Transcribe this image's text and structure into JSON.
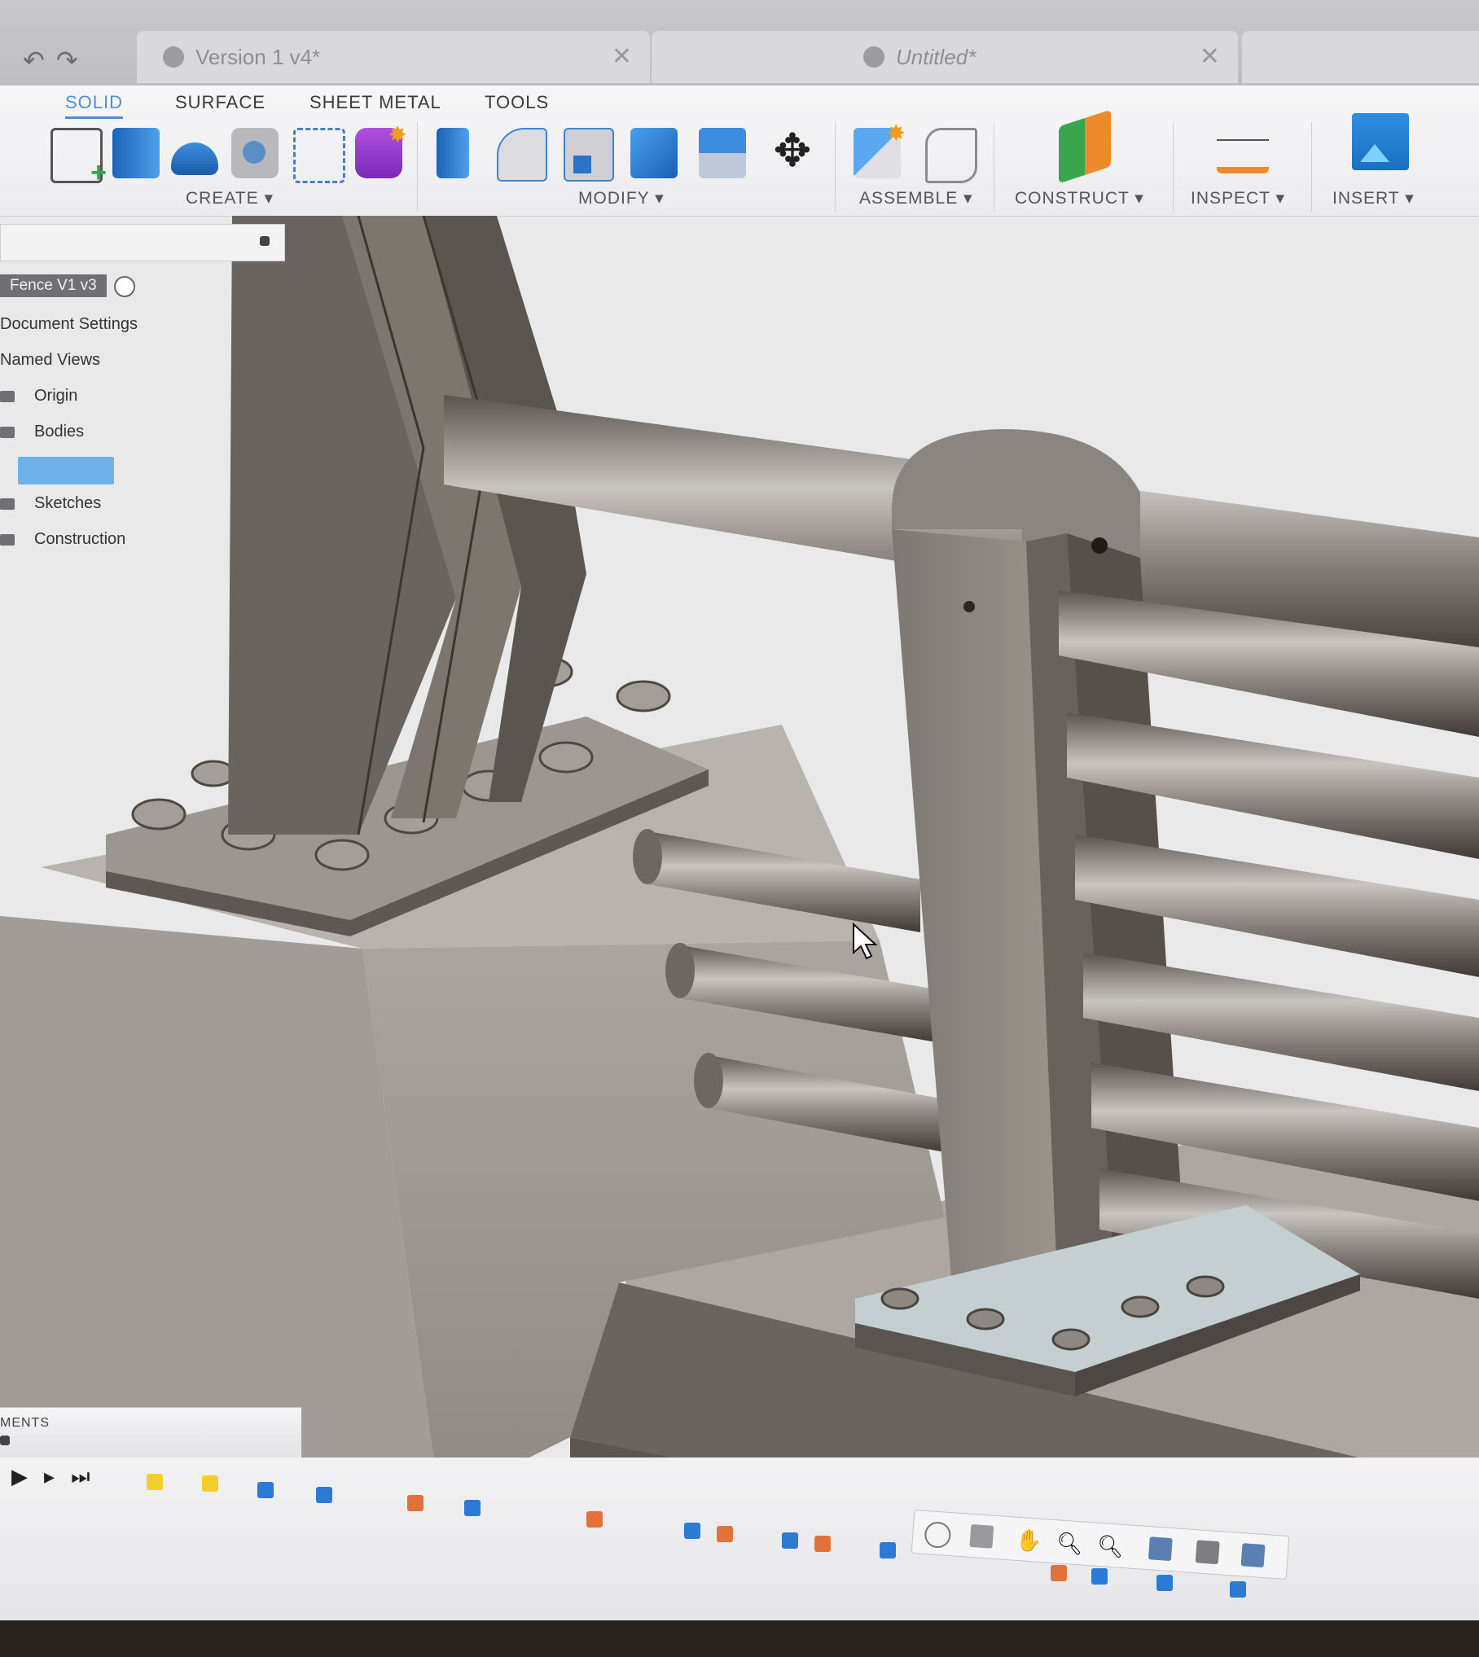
{
  "toolbar": {
    "undo_icon": "undo-icon",
    "redo_icon": "redo-icon"
  },
  "tabs": [
    {
      "label": "Version 1 v4*",
      "active": false
    },
    {
      "label": "Untitled*",
      "active": false
    }
  ],
  "ribbon": {
    "workspace_tabs": [
      "SOLID",
      "SURFACE",
      "SHEET METAL",
      "TOOLS"
    ],
    "active_tab": "SOLID",
    "groups": {
      "create": "CREATE ▾",
      "modify": "MODIFY ▾",
      "assemble": "ASSEMBLE ▾",
      "construct": "CONSTRUCT ▾",
      "inspect": "INSPECT ▾",
      "insert": "INSERT ▾"
    },
    "accent_color": "#4c8fd9"
  },
  "browser": {
    "root": "Fence V1 v3",
    "items": [
      "Document Settings",
      "Named Views",
      "Origin",
      "Bodies",
      "Sketches",
      "Construction"
    ]
  },
  "comments": {
    "label": "MENTS"
  },
  "viewport": {
    "model_color": "#8a8580",
    "background": "#e9e9ea"
  }
}
